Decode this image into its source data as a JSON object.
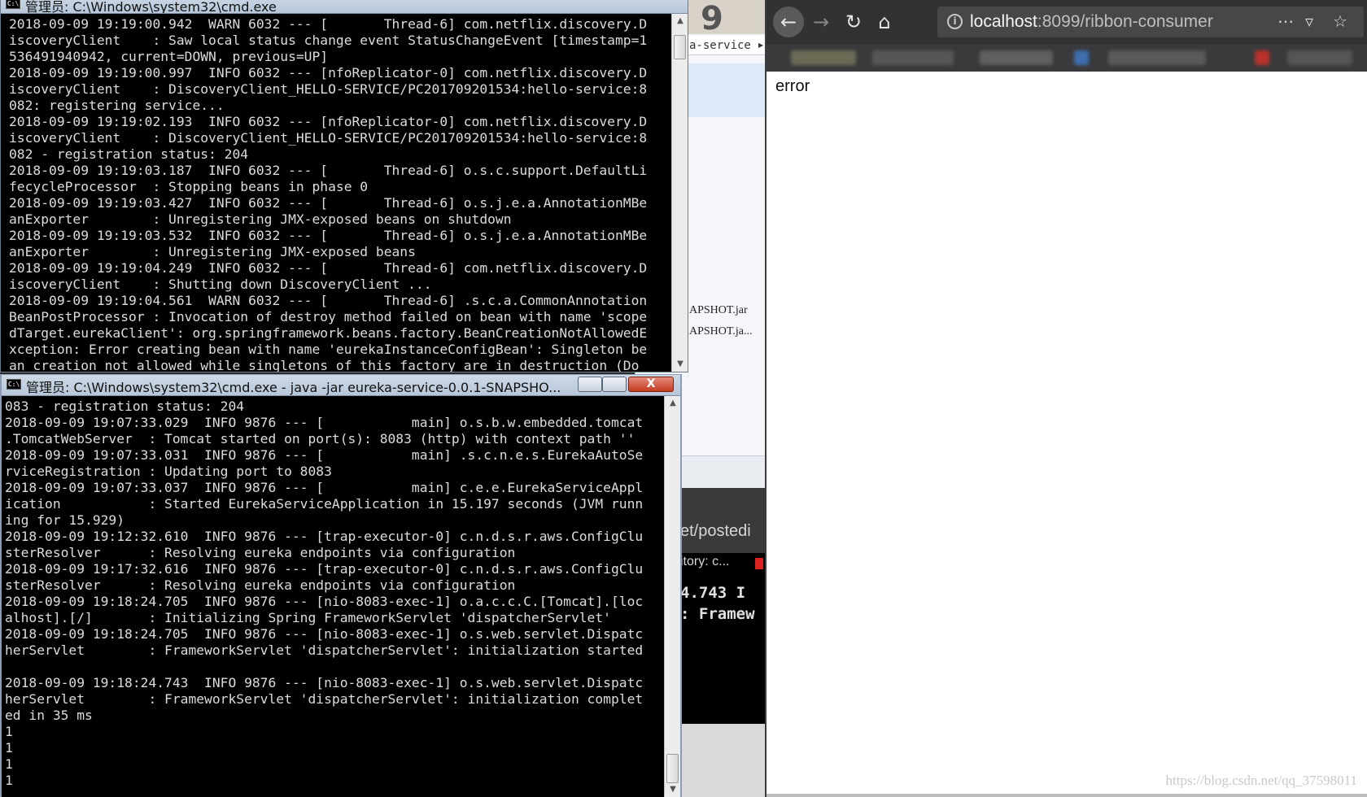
{
  "background": {
    "explorer": {
      "strip_number": "9",
      "address_text": "a-service",
      "files": [
        "APSHOT.jar",
        "APSHOT.ja..."
      ]
    },
    "terminal": {
      "line1": "et/postedi",
      "line2": "itory: c...",
      "line3": "4.743  I",
      "line4": ": Framew"
    }
  },
  "console_top": {
    "title": "管理员: C:\\Windows\\system32\\cmd.exe",
    "lines": [
      "2018-09-09 19:19:00.942  WARN 6032 --- [       Thread-6] com.netflix.discovery.D",
      "iscoveryClient    : Saw local status change event StatusChangeEvent [timestamp=1",
      "536491940942, current=DOWN, previous=UP]",
      "2018-09-09 19:19:00.997  INFO 6032 --- [nfoReplicator-0] com.netflix.discovery.D",
      "iscoveryClient    : DiscoveryClient_HELLO-SERVICE/PC201709201534:hello-service:8",
      "082: registering service...",
      "2018-09-09 19:19:02.193  INFO 6032 --- [nfoReplicator-0] com.netflix.discovery.D",
      "iscoveryClient    : DiscoveryClient_HELLO-SERVICE/PC201709201534:hello-service:8",
      "082 - registration status: 204",
      "2018-09-09 19:19:03.187  INFO 6032 --- [       Thread-6] o.s.c.support.DefaultLi",
      "fecycleProcessor  : Stopping beans in phase 0",
      "2018-09-09 19:19:03.427  INFO 6032 --- [       Thread-6] o.s.j.e.a.AnnotationMBe",
      "anExporter        : Unregistering JMX-exposed beans on shutdown",
      "2018-09-09 19:19:03.532  INFO 6032 --- [       Thread-6] o.s.j.e.a.AnnotationMBe",
      "anExporter        : Unregistering JMX-exposed beans",
      "2018-09-09 19:19:04.249  INFO 6032 --- [       Thread-6] com.netflix.discovery.D",
      "iscoveryClient    : Shutting down DiscoveryClient ...",
      "2018-09-09 19:19:04.561  WARN 6032 --- [       Thread-6] .s.c.a.CommonAnnotation",
      "BeanPostProcessor : Invocation of destroy method failed on bean with name 'scope",
      "dTarget.eurekaClient': org.springframework.beans.factory.BeanCreationNotAllowedE",
      "xception: Error creating bean with name 'eurekaInstanceConfigBean': Singleton be",
      "an creation not allowed while singletons of this factory are in destruction (Do"
    ]
  },
  "console_bottom": {
    "title": "管理员: C:\\Windows\\system32\\cmd.exe - java  -jar eureka-service-0.0.1-SNAPSHO...",
    "close_label": "X",
    "lines": [
      "083 - registration status: 204",
      "2018-09-09 19:07:33.029  INFO 9876 --- [           main] o.s.b.w.embedded.tomcat",
      ".TomcatWebServer  : Tomcat started on port(s): 8083 (http) with context path ''",
      "2018-09-09 19:07:33.031  INFO 9876 --- [           main] .s.c.n.e.s.EurekaAutoSe",
      "rviceRegistration : Updating port to 8083",
      "2018-09-09 19:07:33.037  INFO 9876 --- [           main] c.e.e.EurekaServiceAppl",
      "ication           : Started EurekaServiceApplication in 15.197 seconds (JVM runn",
      "ing for 15.929)",
      "2018-09-09 19:12:32.610  INFO 9876 --- [trap-executor-0] c.n.d.s.r.aws.ConfigClu",
      "sterResolver      : Resolving eureka endpoints via configuration",
      "2018-09-09 19:17:32.616  INFO 9876 --- [trap-executor-0] c.n.d.s.r.aws.ConfigClu",
      "sterResolver      : Resolving eureka endpoints via configuration",
      "2018-09-09 19:18:24.705  INFO 9876 --- [nio-8083-exec-1] o.a.c.c.C.[Tomcat].[loc",
      "alhost].[/]       : Initializing Spring FrameworkServlet 'dispatcherServlet'",
      "2018-09-09 19:18:24.705  INFO 9876 --- [nio-8083-exec-1] o.s.web.servlet.Dispatc",
      "herServlet        : FrameworkServlet 'dispatcherServlet': initialization started",
      "",
      "2018-09-09 19:18:24.743  INFO 9876 --- [nio-8083-exec-1] o.s.web.servlet.Dispatc",
      "herServlet        : FrameworkServlet 'dispatcherServlet': initialization complet",
      "ed in 35 ms",
      "1",
      "1",
      "1",
      "1"
    ]
  },
  "browser": {
    "url_host": "localhost",
    "url_rest": ":8099/ribbon-consumer",
    "page_text": "error",
    "watermark": "https://blog.csdn.net/qq_37598011"
  }
}
